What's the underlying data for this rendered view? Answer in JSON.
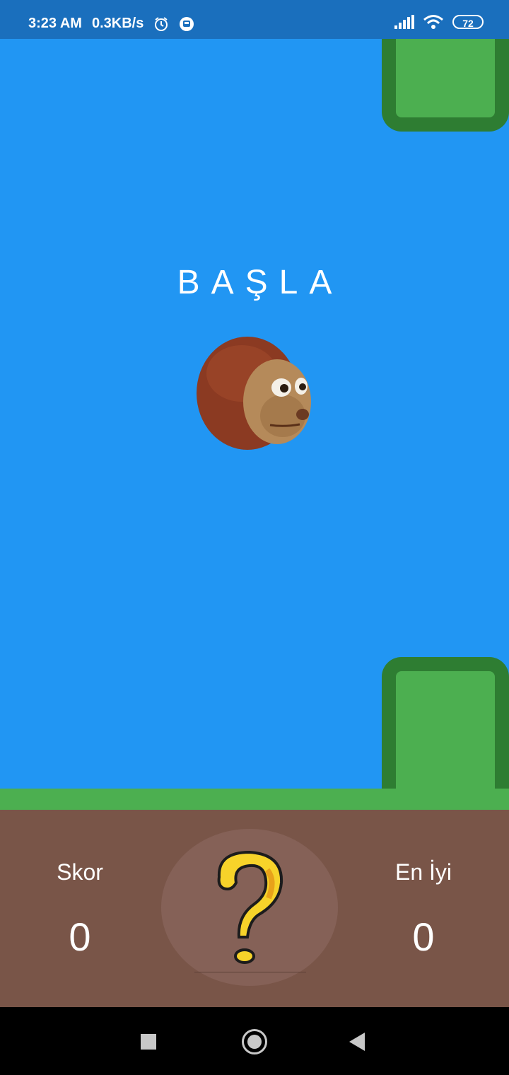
{
  "status_bar": {
    "time": "3:23 AM",
    "speed": "0.3KB/s",
    "battery": "72",
    "icons": [
      "alarm-icon",
      "sync-icon",
      "signal-icon",
      "wifi-icon",
      "battery-icon"
    ]
  },
  "game": {
    "start_label": "BAŞLA",
    "player": "monkey-puppet-face",
    "colors": {
      "sky": "#2196f3",
      "pipe_border": "#2e7d32",
      "pipe_fill": "#4caf50",
      "grass": "#4caf50",
      "ground": "#795548"
    }
  },
  "hud": {
    "score_label": "Skor",
    "score_value": "0",
    "best_label": "En İyi",
    "best_value": "0",
    "help_icon": "question-mark-icon"
  },
  "navigation": {
    "buttons": [
      "recents-button",
      "home-button",
      "back-button"
    ]
  }
}
